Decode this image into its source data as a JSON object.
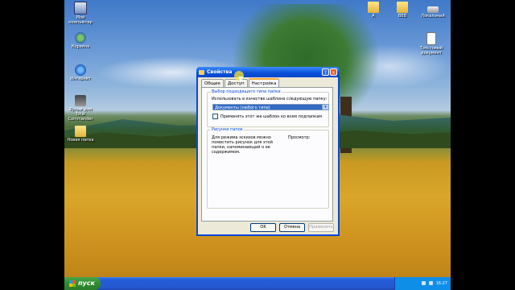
{
  "desktop": {
    "icons_left": [
      {
        "label": "Мой компьютер",
        "icon": "computer-icon"
      },
      {
        "label": "Корзина",
        "icon": "network-icon"
      },
      {
        "label": "Интернет",
        "icon": "ie-icon"
      },
      {
        "label": "Ярлык для Total Commander",
        "icon": "shortcut-icon"
      },
      {
        "label": "Новая папка",
        "icon": "folder-icon"
      }
    ],
    "icons_right": [
      {
        "label": "А",
        "icon": "folder-icon"
      },
      {
        "label": "ВВВ",
        "icon": "folder-icon"
      },
      {
        "label": "Локальный",
        "icon": "drive-icon"
      },
      {
        "label": "Текстовый документ",
        "icon": "document-icon"
      }
    ]
  },
  "dialog": {
    "title": "Свойства",
    "help_glyph": "?",
    "close_glyph": "×",
    "tabs": [
      "Общие",
      "Доступ",
      "Настройка"
    ],
    "active_tab": "Настройка",
    "group1_title": "Выбор подходящего типа папки",
    "group1_label": "Использовать в качестве шаблона следующую папку:",
    "template_value": "Документы (любого типа)",
    "dropdown_arrow": "▾",
    "apply_checkbox_label": "Применять этот же шаблон ко всем подпапкам",
    "apply_checked": false,
    "group2_title": "Рисунки папок",
    "group2_text": "Для режима эскизов можно поместить рисунок для этой папки, напоминающий о ее содержимом.",
    "preview_label": "Просмотр:",
    "buttons": {
      "ok": "OK",
      "cancel": "Отмена",
      "apply": "Применить"
    }
  },
  "taskbar": {
    "start_label": "пуск",
    "clock": "16:27"
  },
  "colors": {
    "titlebar": "#0a4fd9",
    "dialog_bg": "#ece9d8",
    "start_green": "#2f8a2f",
    "taskbar_blue": "#245ddb",
    "selection": "#316ac5"
  }
}
